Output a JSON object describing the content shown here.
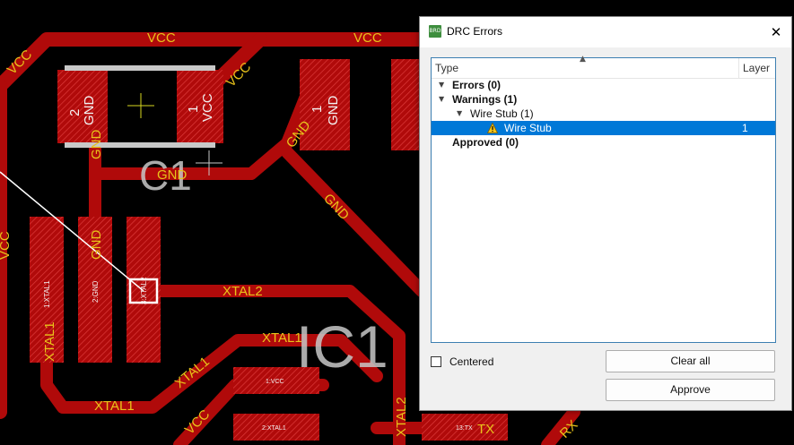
{
  "board": {
    "nets": {
      "vcc": "VCC",
      "gnd": "GND",
      "xtal1": "XTAL1",
      "xtal2": "XTAL2",
      "tx": "TX",
      "rx": "RX"
    },
    "pads": {
      "c1_2": "2",
      "c1_1": "1",
      "p3_1": "1",
      "xt_1": "1:XTAL1",
      "xt_2": "2:GND",
      "xt_3": "3:XTAL2",
      "h_1": "1:VCC",
      "h_2": "2:XTAL1",
      "h_13": "13:TX"
    },
    "silk": {
      "c1": "C1",
      "ic1": "IC1"
    },
    "colors": {
      "background": "#000000",
      "copper": "#b00a0a",
      "net_label": "#e8c21a",
      "silk": "#c8c8c8",
      "airwire": "#ffffff"
    }
  },
  "dialog": {
    "title": "DRC Errors",
    "icon": "brd-app-icon",
    "close_icon": "close-icon",
    "columns": {
      "type": "Type",
      "layer": "Layer"
    },
    "tree": {
      "errors": "Errors (0)",
      "warnings": "Warnings (1)",
      "wire_stub_group": "Wire Stub (1)",
      "wire_stub_item": "Wire Stub",
      "wire_stub_layer": "1",
      "approved": "Approved (0)"
    },
    "centered_label": "Centered",
    "clear_all_label": "Clear all",
    "approve_label": "Approve"
  }
}
